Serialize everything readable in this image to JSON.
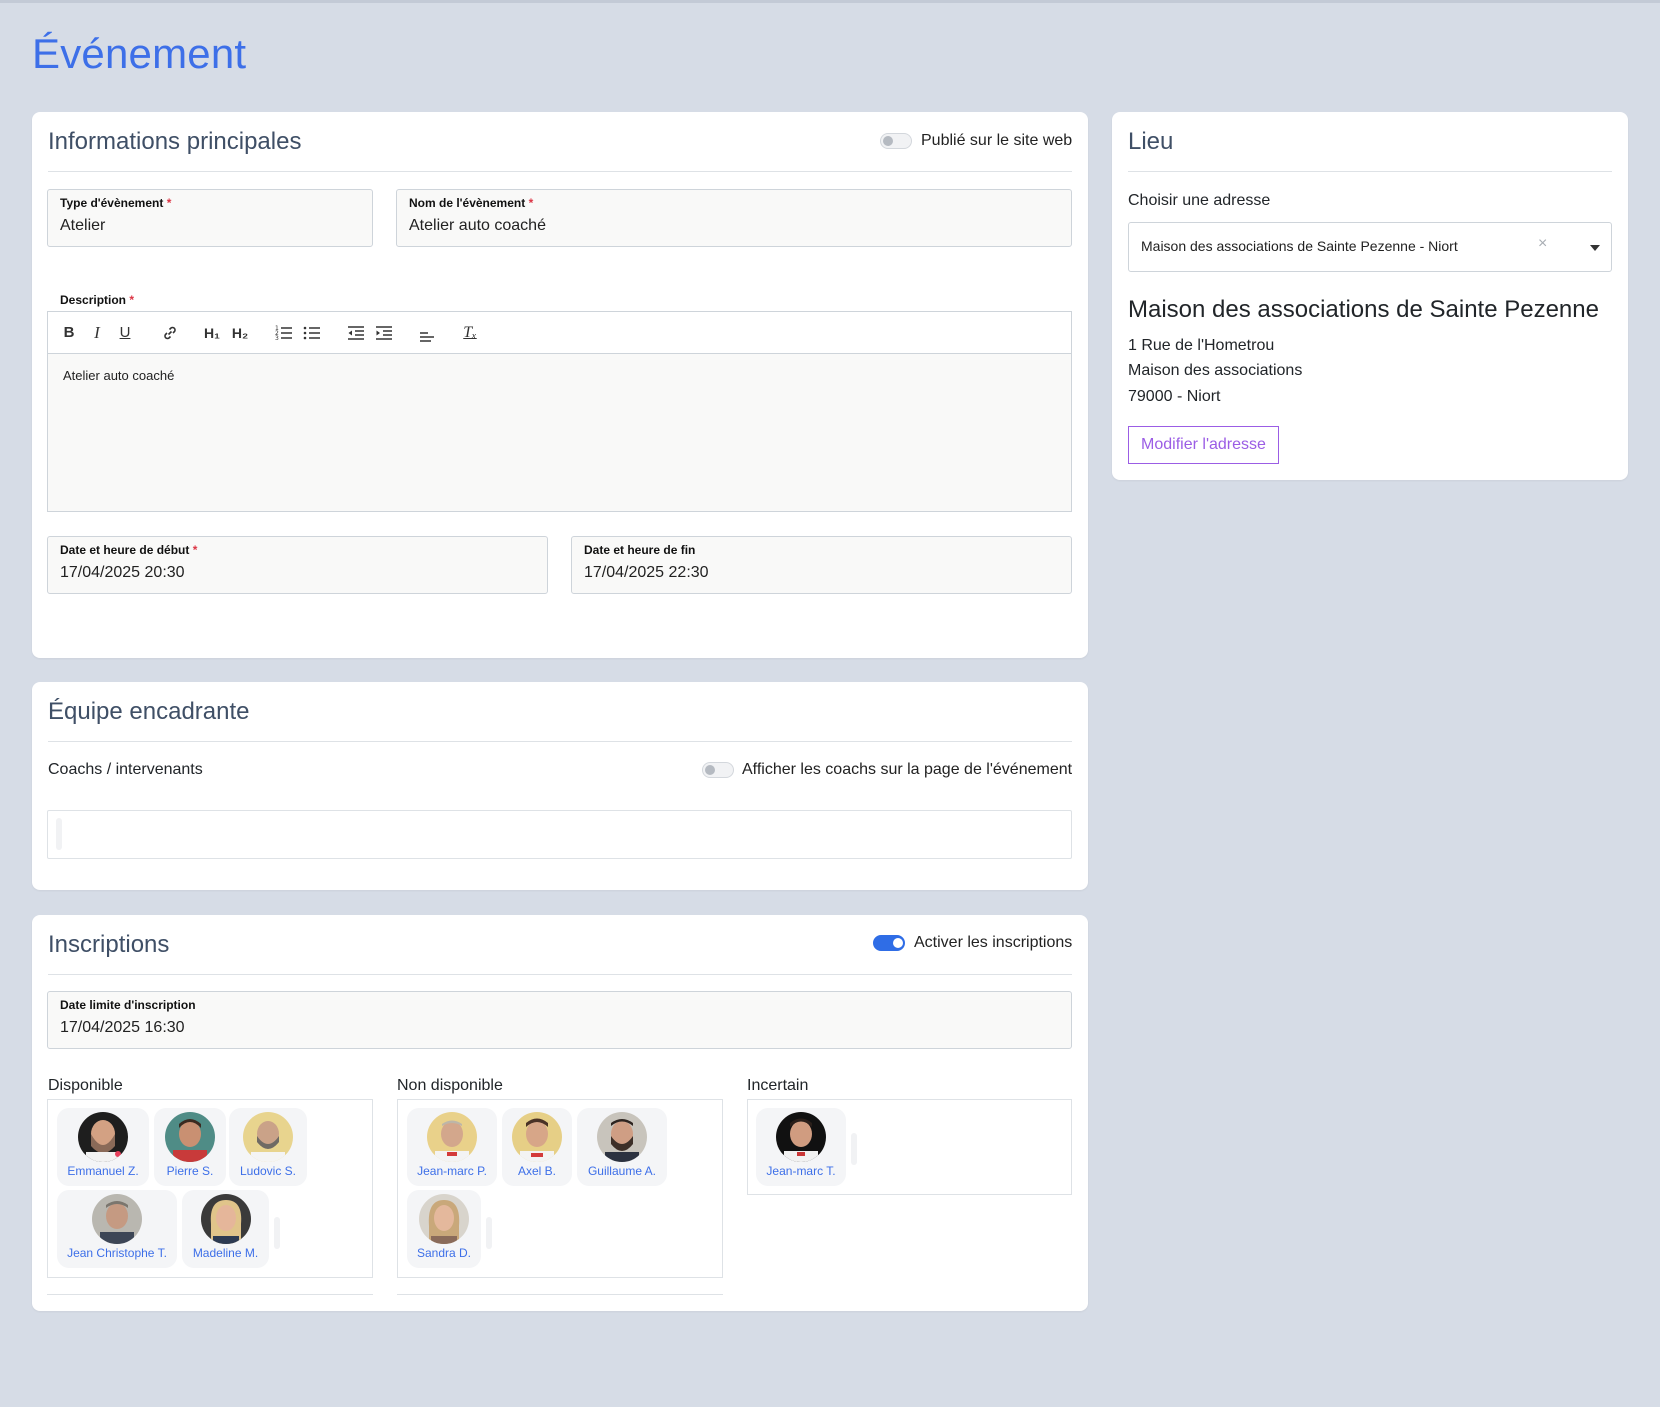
{
  "page": {
    "title": "Événement"
  },
  "main_info": {
    "title": "Informations principales",
    "published_label": "Publié sur le site web",
    "published": false,
    "type": {
      "label": "Type d'évènement",
      "required_mark": "*",
      "value": "Atelier"
    },
    "name": {
      "label": "Nom de l'évènement",
      "required_mark": "*",
      "value": "Atelier auto coaché"
    },
    "description": {
      "label": "Description",
      "required_mark": "*",
      "value": "Atelier auto coaché"
    },
    "toolbar": {
      "bold": "B",
      "italic": "I",
      "underline": "U",
      "h1": "H₁",
      "h2": "H₂",
      "clear": "Tₓ"
    },
    "start": {
      "label": "Date et heure de début",
      "required_mark": "*",
      "value": "17/04/2025 20:30"
    },
    "end": {
      "label": "Date et heure de fin",
      "value": "17/04/2025 22:30"
    }
  },
  "lieu": {
    "title": "Lieu",
    "choose_label": "Choisir une adresse",
    "selected": "Maison des associations de Sainte Pezenne - Niort",
    "clear_glyph": "×",
    "place_name": "Maison des associations de Sainte Pezenne",
    "address_lines": [
      "1 Rue de l'Hometrou",
      "Maison des associations",
      "79000 - Niort"
    ],
    "modify_button": "Modifier l'adresse"
  },
  "team": {
    "title": "Équipe encadrante",
    "coaches_label": "Coachs / intervenants",
    "show_coaches_label": "Afficher les coachs sur la page de l'événement",
    "show_coaches": false
  },
  "inscriptions": {
    "title": "Inscriptions",
    "enable_label": "Activer les inscriptions",
    "enabled": true,
    "deadline": {
      "label": "Date limite d'inscription",
      "value": "17/04/2025 16:30"
    },
    "groups": [
      {
        "label": "Disponible",
        "people": [
          "Emmanuel Z.",
          "Pierre S.",
          "Ludovic S.",
          "Jean Christophe T.",
          "Madeline M."
        ]
      },
      {
        "label": "Non disponible",
        "people": [
          "Jean-marc P.",
          "Axel B.",
          "Guillaume A.",
          "Sandra D."
        ]
      },
      {
        "label": "Incertain",
        "people": [
          "Jean-marc T."
        ]
      }
    ]
  },
  "colors": {
    "accent": "#3d6fe8",
    "button_outline": "#9b5de5",
    "required": "#dc3545",
    "background": "#d6dce6"
  }
}
